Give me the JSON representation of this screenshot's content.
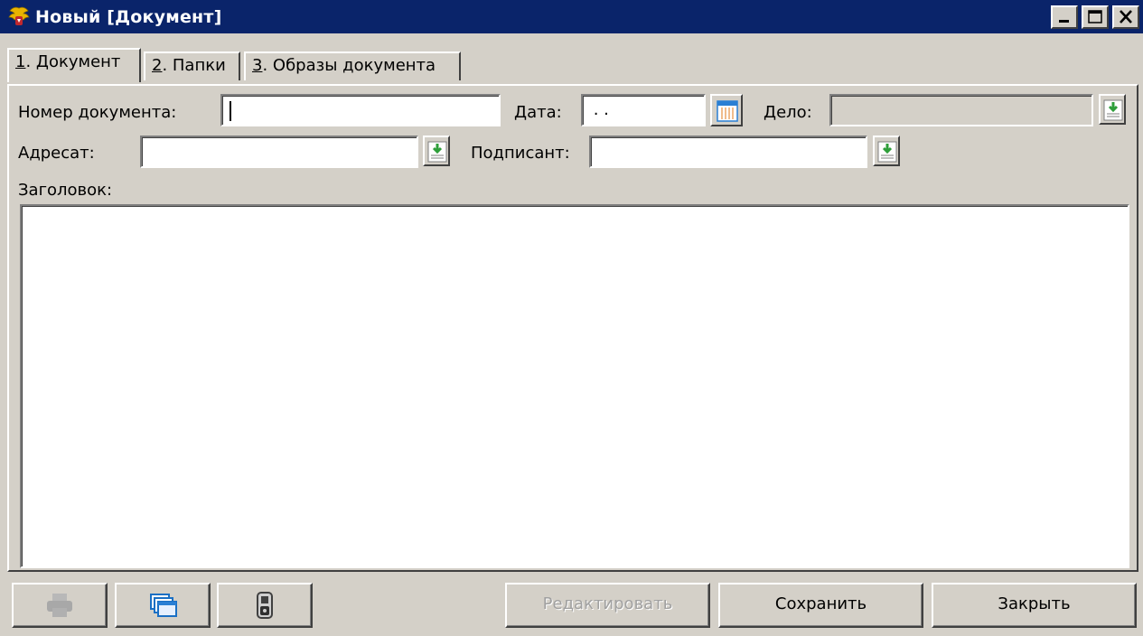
{
  "window": {
    "title": "Новый [Документ]",
    "icons": [
      "emblem-icon",
      "minimize-icon",
      "maximize-icon",
      "close-icon"
    ]
  },
  "tabs": [
    {
      "key": "1",
      "label": ". Документ",
      "active": true
    },
    {
      "key": "2",
      "label": ". Папки",
      "active": false
    },
    {
      "key": "3",
      "label": ". Образы документа",
      "active": false
    }
  ],
  "form": {
    "doc_number_label": "Номер документа:",
    "doc_number_value": "",
    "date_label": "Дата:",
    "date_value": " . .",
    "case_label": "Дело:",
    "case_value": "",
    "addressee_label": "Адресат:",
    "addressee_value": "",
    "signer_label": "Подписант:",
    "signer_value": "",
    "heading_label": "Заголовок:",
    "heading_value": ""
  },
  "toolbar": {
    "print_icon": "printer-icon",
    "windows_icon": "windows-icon",
    "lock_icon": "lock-icon",
    "edit_label": "Редактировать",
    "save_label": "Сохранить",
    "close_label": "Закрыть"
  },
  "colors": {
    "titlebar": "#0a246a",
    "face": "#d4d0c8",
    "accent_green": "#2e9e3a",
    "accent_blue": "#2a7fd4"
  }
}
